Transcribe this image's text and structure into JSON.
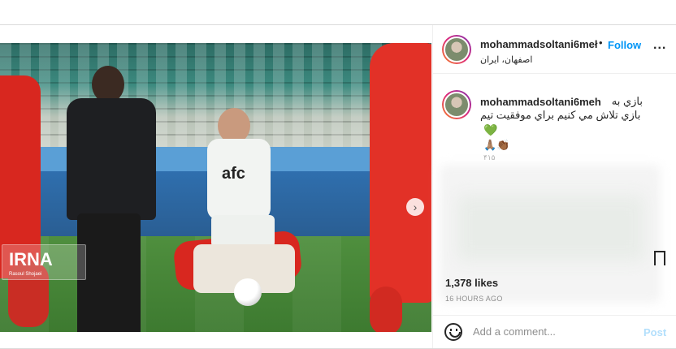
{
  "post": {
    "username": "mohammadsoltani6meh",
    "username_header": "mohammadsoltani6meł",
    "follow_label": "Follow",
    "separator": "•",
    "location": "اصفهان، ایران",
    "more_label": "...",
    "caption_line1": "بازي به",
    "caption_line2": "بازي تلاش مي كنيم براي موفقيت تيم",
    "caption_heart": "💚",
    "caption_emojis": "🙏🏽👏🏾",
    "caption_faint": "۴۱۵",
    "likes": "1,378 likes",
    "time": "16 HOURS AGO",
    "comment_placeholder": "Add a comment...",
    "post_label": "Post"
  },
  "media": {
    "watermark_logo": "IRNA",
    "watermark_credit": "Rasoul Shojaei",
    "jersey_text": "afc",
    "next_icon": "chevron-right-icon",
    "carousel_count": 5,
    "carousel_active": 0
  },
  "colors": {
    "accent": "#0095f6",
    "post_disabled": "#b2dffc",
    "muted": "#8e8e8e"
  }
}
